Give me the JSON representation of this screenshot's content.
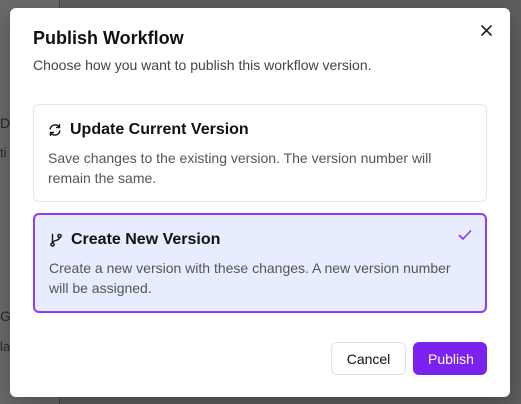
{
  "background": {
    "fragments": [
      "D",
      "ti",
      "G",
      "la"
    ]
  },
  "dialog": {
    "title": "Publish Workflow",
    "subtitle": "Choose how you want to publish this workflow version.",
    "close_icon": "close-icon",
    "options": [
      {
        "icon": "refresh-icon",
        "title": "Update Current Version",
        "description": "Save changes to the existing version. The version number will remain the same.",
        "selected": false
      },
      {
        "icon": "git-branch-icon",
        "title": "Create New Version",
        "description": "Create a new version with these changes. A new version number will be assigned.",
        "selected": true
      }
    ],
    "buttons": {
      "cancel_label": "Cancel",
      "publish_label": "Publish"
    }
  },
  "colors": {
    "accent": "#7c22f0",
    "selected_bg": "#e8ecff",
    "selected_border": "#8b3dff",
    "overlay": "#5e5e5e"
  }
}
